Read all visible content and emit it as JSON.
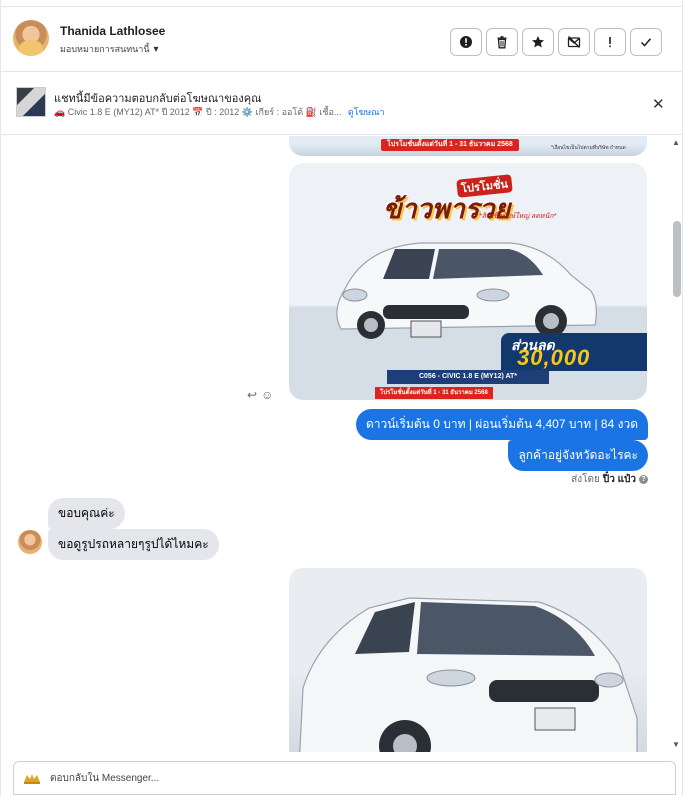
{
  "contact": {
    "name": "Thanida Lathlosee",
    "assign_label": "มอบหมายการสนทนานี้"
  },
  "toolbar": {
    "buttons": [
      "report-icon",
      "trash-icon",
      "star-icon",
      "mark-unread-icon",
      "important-icon",
      "done-icon"
    ]
  },
  "ad": {
    "title": "แชทนี้มีข้อความตอบกลับต่อโฆษณาของคุณ",
    "desc": "🚗 Civic 1.8 E (MY12) AT* ปี 2012 📅 ปี : 2012 ⚙️ เกียร์ : ออโต้ ⛽ เชื้อ...",
    "link": "ดูโฆษณา"
  },
  "convo": {
    "img_top": {
      "promo_date": "โปรโมชั่นตั้งแต่วันที่ 1 - 31 ธันวาคม 2568",
      "fine_print": "*เงื่อนไขเป็นไปตามที่บริษัท กำหนด"
    },
    "car1": {
      "promo_small": "โปรโมชั่น",
      "promo_big": "ข้าวพารวย",
      "promo_sub": "*สินเชื่อยักษ์ใหญ่ ลดหนัก*",
      "discount_label": "ส่วนลด",
      "discount_amount": "30,000",
      "model_tag": "C056 - CIVIC 1.8 E (MY12) AT*",
      "promo_date": "โปรโมชั่นตั้งแต่วันที่ 1 - 31 ธันวาคม 2568"
    },
    "outgoing": [
      "ดาวน์เริ่มต้น 0 บาท | ผ่อนเริ่มต้น 4,407 บาท | 84 งวด",
      "ลูกค้าอยู่จังหวัดอะไรคะ"
    ],
    "sent_by_prefix": "ส่งโดย",
    "sent_by_name": "ปิ๋ว แป๋ว",
    "incoming": [
      "ขอบคุณค่ะ",
      "ขอดูรูปรถหลายๆรูปได้ไหมคะ"
    ]
  },
  "composer": {
    "placeholder": "ตอบกลับใน Messenger..."
  }
}
